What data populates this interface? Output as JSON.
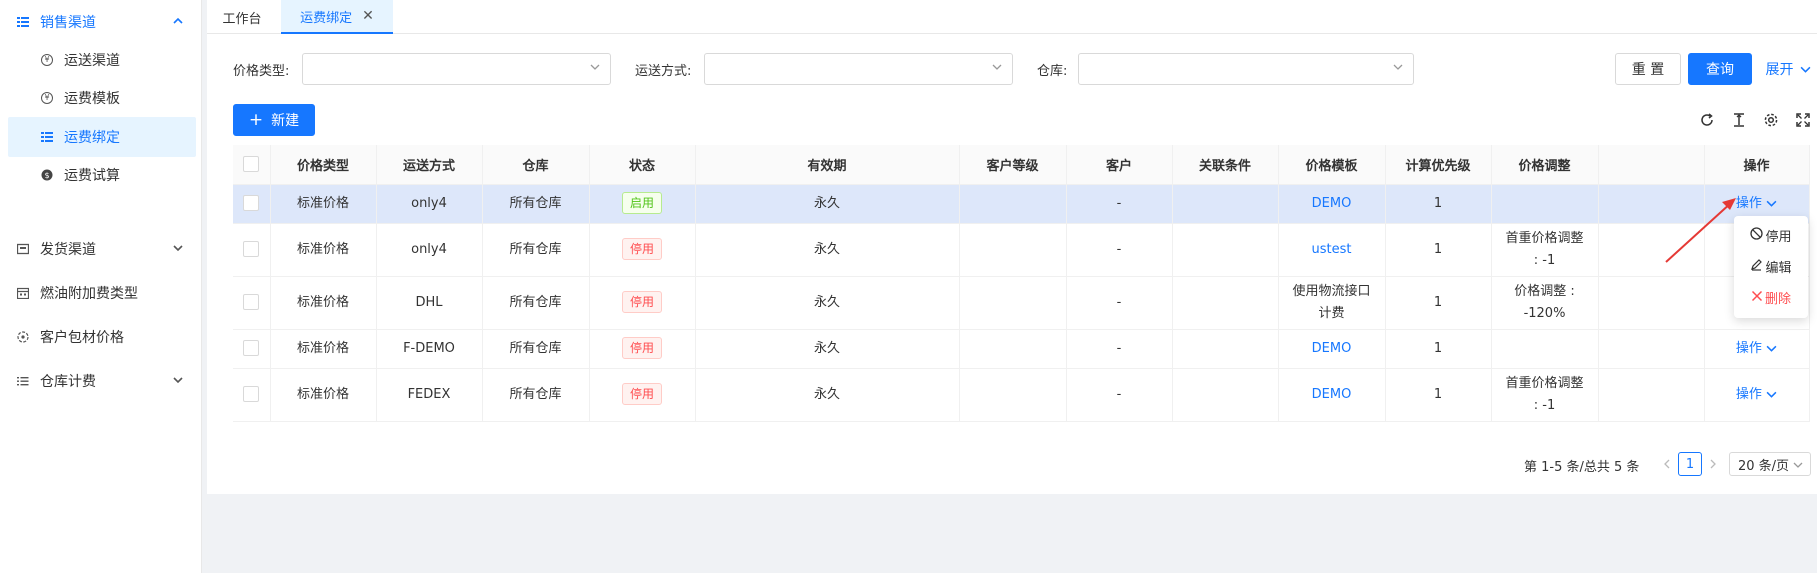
{
  "sidebar": {
    "items": [
      {
        "label": "销售渠道",
        "icon": "channel-icon",
        "level": "group",
        "expanded": true
      },
      {
        "label": "运送渠道",
        "icon": "currency-icon",
        "level": "sub"
      },
      {
        "label": "运费模板",
        "icon": "currency-icon",
        "level": "sub"
      },
      {
        "label": "运费绑定",
        "icon": "list-icon",
        "level": "sub",
        "selected": true
      },
      {
        "label": "运费试算",
        "icon": "coin-icon",
        "level": "sub"
      },
      {
        "label": "发货渠道",
        "icon": "box-icon",
        "level": "group"
      },
      {
        "label": "燃油附加费类型",
        "icon": "calendar-icon",
        "level": "group"
      },
      {
        "label": "客户包材价格",
        "icon": "package-icon",
        "level": "group"
      },
      {
        "label": "仓库计费",
        "icon": "menu-list-icon",
        "level": "group"
      }
    ]
  },
  "tabs": [
    {
      "label": "工作台"
    },
    {
      "label": "运费绑定",
      "active": true,
      "closable": true
    }
  ],
  "filters": {
    "price_type_label": "价格类型:",
    "ship_method_label": "运送方式:",
    "warehouse_label": "仓库:",
    "reset": "重 置",
    "query": "查询",
    "expand": "展开"
  },
  "toolbar": {
    "new": "新建"
  },
  "table": {
    "columns": [
      "价格类型",
      "运送方式",
      "仓库",
      "状态",
      "有效期",
      "客户等级",
      "客户",
      "关联条件",
      "价格模板",
      "计算优先级",
      "价格调整",
      "",
      "操作"
    ],
    "rows": [
      {
        "price_type": "标准价格",
        "ship": "only4",
        "warehouse": "所有仓库",
        "status": "启用",
        "status_kind": "on",
        "valid": "永久",
        "level": "",
        "customer": "-",
        "cond": "",
        "template": "DEMO",
        "template_link": true,
        "priority": "1",
        "adjust": "",
        "action": "操作",
        "highlight": true
      },
      {
        "price_type": "标准价格",
        "ship": "only4",
        "warehouse": "所有仓库",
        "status": "停用",
        "status_kind": "off",
        "valid": "永久",
        "level": "",
        "customer": "-",
        "cond": "",
        "template": "ustest",
        "template_link": true,
        "priority": "1",
        "adjust": "首重价格调整 : -1",
        "action": ""
      },
      {
        "price_type": "标准价格",
        "ship": "DHL",
        "warehouse": "所有仓库",
        "status": "停用",
        "status_kind": "off",
        "valid": "永久",
        "level": "",
        "customer": "-",
        "cond": "",
        "template": "使用物流接口计费",
        "template_link": false,
        "priority": "1",
        "adjust": "价格调整 : -120%",
        "action": ""
      },
      {
        "price_type": "标准价格",
        "ship": "F-DEMO",
        "warehouse": "所有仓库",
        "status": "停用",
        "status_kind": "off",
        "valid": "永久",
        "level": "",
        "customer": "-",
        "cond": "",
        "template": "DEMO",
        "template_link": true,
        "priority": "1",
        "adjust": "",
        "action": "操作"
      },
      {
        "price_type": "标准价格",
        "ship": "FEDEX",
        "warehouse": "所有仓库",
        "status": "停用",
        "status_kind": "off",
        "valid": "永久",
        "level": "",
        "customer": "-",
        "cond": "",
        "template": "DEMO",
        "template_link": true,
        "priority": "1",
        "adjust": "首重价格调整 : -1",
        "action": "操作"
      }
    ]
  },
  "dropdown": {
    "items": [
      {
        "label": "停用",
        "icon": "ban-icon"
      },
      {
        "label": "编辑",
        "icon": "edit-icon"
      },
      {
        "label": "删除",
        "icon": "close-icon",
        "danger": true
      }
    ]
  },
  "pagination": {
    "total": "第 1-5 条/总共 5 条",
    "current": "1",
    "page_size": "20 条/页"
  },
  "colors": {
    "primary": "#1677ff",
    "danger": "#ff4d4f",
    "success": "#52c41a",
    "highlight_row": "#dde7fa"
  }
}
